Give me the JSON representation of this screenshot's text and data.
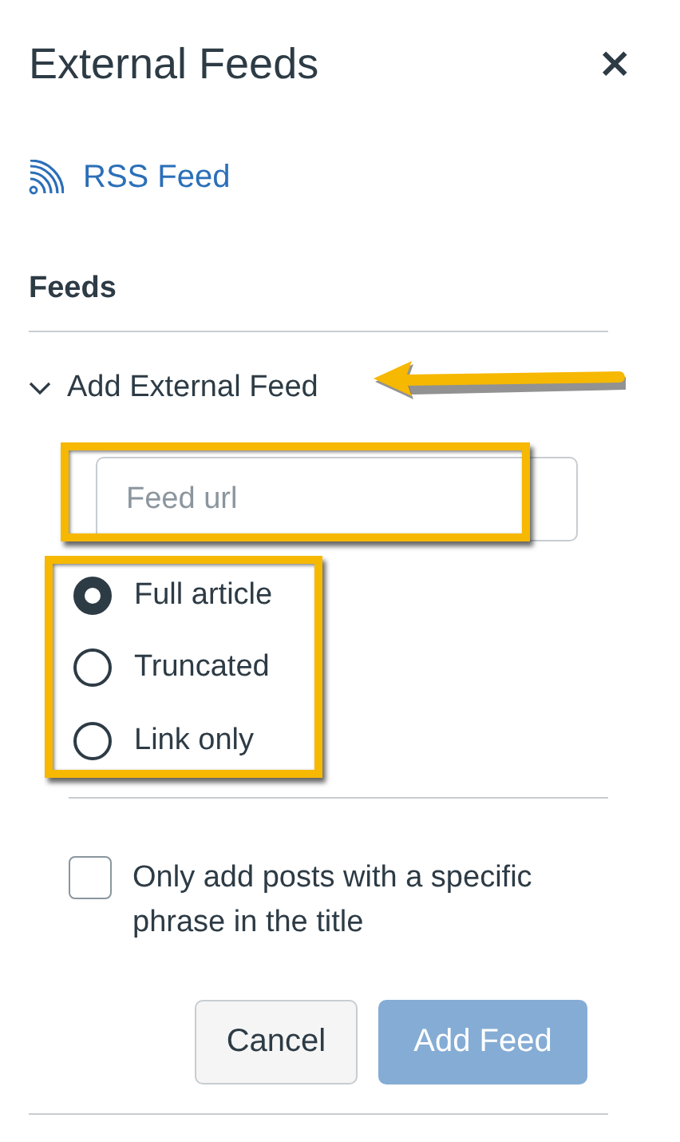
{
  "panel": {
    "title": "External Feeds",
    "close": "×"
  },
  "rss_link": "RSS Feed",
  "section_title": "Feeds",
  "disclosure": {
    "label": "Add External Feed",
    "expanded": true
  },
  "url_field": {
    "placeholder": "Feed url"
  },
  "options": [
    {
      "label": "Full article",
      "selected": true
    },
    {
      "label": "Truncated",
      "selected": false
    },
    {
      "label": "Link only",
      "selected": false
    }
  ],
  "phrase_filter": {
    "label": "Only add posts with a specific phrase in the title",
    "checked": false
  },
  "buttons": [
    {
      "label": "Cancel",
      "kind": "secondary",
      "disabled": false
    },
    {
      "label": "Add Feed",
      "kind": "primary",
      "disabled": true
    }
  ]
}
